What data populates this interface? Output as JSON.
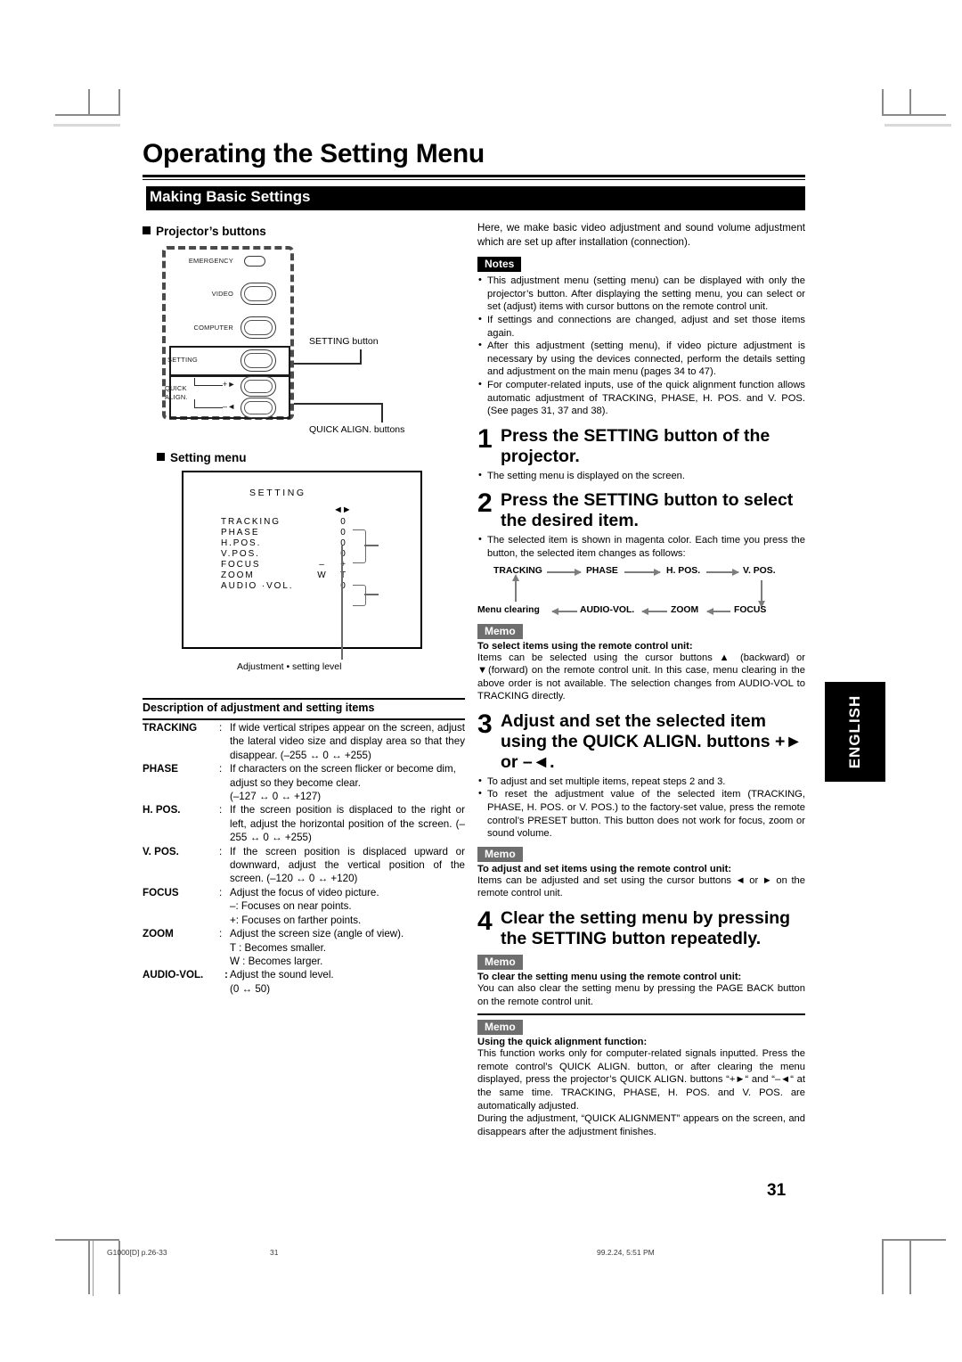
{
  "document": {
    "title": "Operating the Setting Menu",
    "section_banner": "Making Basic Settings",
    "page_number": "31",
    "side_tab": "ENGLISH"
  },
  "left": {
    "projector_buttons_heading": "Projector’s buttons",
    "setting_menu_heading": "Setting menu",
    "panel": {
      "labels": [
        "EMERGENCY",
        "VIDEO",
        "COMPUTER",
        "SETTING",
        "QUICK",
        "ALIGN."
      ],
      "quick_plus": "+",
      "quick_minus": "–"
    },
    "callouts": {
      "setting_button": "SETTING button",
      "quick_align_buttons": "QUICK ALIGN. buttons"
    },
    "menu_screen": {
      "title": "SETTING",
      "cursor": "◄►",
      "rows": [
        {
          "label": "TRACKING",
          "left": "",
          "right": "0"
        },
        {
          "label": "PHASE",
          "left": "",
          "right": "0"
        },
        {
          "label": "H.POS.",
          "left": "",
          "right": "0"
        },
        {
          "label": "V.POS.",
          "left": "",
          "right": "0"
        },
        {
          "label": "FOCUS",
          "left": "–",
          "right": "+"
        },
        {
          "label": "ZOOM",
          "left": "W",
          "right": "T"
        },
        {
          "label": "AUDIO ·VOL.",
          "left": "",
          "right": "0"
        }
      ],
      "caption": "Adjustment • setting level"
    },
    "description": {
      "title": "Description of adjustment and setting items",
      "items": [
        {
          "term": "TRACKING",
          "body": "If wide vertical stripes appear on the screen, adjust the lateral video size and display area so that they disappear. (–255 ↔ 0 ↔ +255)"
        },
        {
          "term": "PHASE",
          "body": "If characters on the screen flicker or become dim, adjust so they become clear.",
          "extra": [
            "(–127 ↔ 0 ↔ +127)"
          ]
        },
        {
          "term": "H. POS.",
          "body": "If the screen position is displaced to the right or left, adjust the horizontal position of the screen. (–255 ↔ 0 ↔ +255)"
        },
        {
          "term": "V. POS.",
          "body": "If the screen position is displaced upward or downward, adjust the vertical position of the screen. (–120 ↔ 0 ↔ +120)"
        },
        {
          "term": "FOCUS",
          "body": "Adjust the focus of video picture.",
          "extra": [
            "–: Focuses on near points.",
            "+: Focuses on farther points."
          ]
        },
        {
          "term": "ZOOM",
          "body": "Adjust the screen size (angle of view).",
          "extra": [
            "T  : Becomes smaller.",
            "W : Becomes larger."
          ]
        },
        {
          "term": "AUDIO-VOL.",
          "body": "Adjust the sound level.",
          "extra": [
            "(0 ↔ 50)"
          ]
        }
      ]
    }
  },
  "right": {
    "intro": "Here, we make basic video adjustment and sound volume adjustment which are set up after installation (connection).",
    "notes_tag": "Notes",
    "notes": [
      "This adjustment menu (setting menu) can be displayed with only the projector’s button. After displaying the setting menu, you can select or set (adjust) items with cursor buttons on the remote control unit.",
      "If settings and connections are changed, adjust and set those items again.",
      "After this adjustment (setting menu), if video picture adjustment is necessary by using the devices connected, perform the details setting and adjustment on the main menu (pages 34 to 47).",
      "For computer-related inputs, use of the quick alignment function allows automatic adjustment of TRACKING, PHASE, H. POS. and V. POS. (See pages 31, 37 and 38)."
    ],
    "steps": [
      {
        "num": "1",
        "heading": "Press the SETTING button of the projector.",
        "bullets": [
          "The setting menu is displayed on the screen."
        ]
      },
      {
        "num": "2",
        "heading": "Press the SETTING button to select the desired item.",
        "bullets": [
          "The selected item is shown in magenta color. Each time you press the button, the selected item changes as follows:"
        ]
      },
      {
        "num": "3",
        "heading": "Adjust and set the selected item using the QUICK ALIGN. buttons +► or –◄.",
        "bullets": [
          "To adjust and set multiple items, repeat steps 2 and 3.",
          "To reset the adjustment value of the selected item (TRACKING, PHASE, H. POS. or V. POS.) to the factory-set value, press the remote control’s PRESET button. This button does not work for focus, zoom or sound volume."
        ]
      },
      {
        "num": "4",
        "heading": "Clear the setting menu by pressing the SETTING button repeatedly.",
        "bullets": []
      }
    ],
    "flow_diagram": {
      "top_row": [
        "TRACKING",
        "PHASE",
        "H. POS.",
        "V. POS."
      ],
      "bottom_row": [
        "Menu clearing",
        "AUDIO-VOL.",
        "ZOOM",
        "FOCUS"
      ]
    },
    "memo_tag": "Memo",
    "memos": [
      {
        "head": "To select items using the remote control unit:",
        "body": "Items can be selected using the cursor buttons ▲ (backward) or ▼(forward) on the remote control unit. In this case, menu clearing in the above order is not available. The selection changes from AUDIO-VOL to TRACKING directly."
      },
      {
        "head": "To adjust and set items using the remote control unit:",
        "body": "Items can be adjusted and set using the cursor buttons ◄ or ► on the remote control unit."
      },
      {
        "head": "To clear the setting menu using the remote control unit:",
        "body": "You can also clear the setting menu by pressing the PAGE BACK button on the remote control unit."
      },
      {
        "head": "Using the quick alignment function:",
        "body": "This function works only for computer-related signals inputted. Press the remote control’s QUICK ALIGN. button, or after clearing the menu displayed, press the projector’s QUICK ALIGN. buttons “+►“ and “–◄“ at the same time. TRACKING, PHASE, H. POS. and V. POS. are automatically adjusted.",
        "body2": "During the adjustment, “QUICK ALIGNMENT” appears on the screen, and disappears after the adjustment finishes."
      }
    ]
  },
  "footer": {
    "left": "G1000[D]  p.26-33",
    "center": "31",
    "right": "99.2.24, 5:51 PM"
  }
}
